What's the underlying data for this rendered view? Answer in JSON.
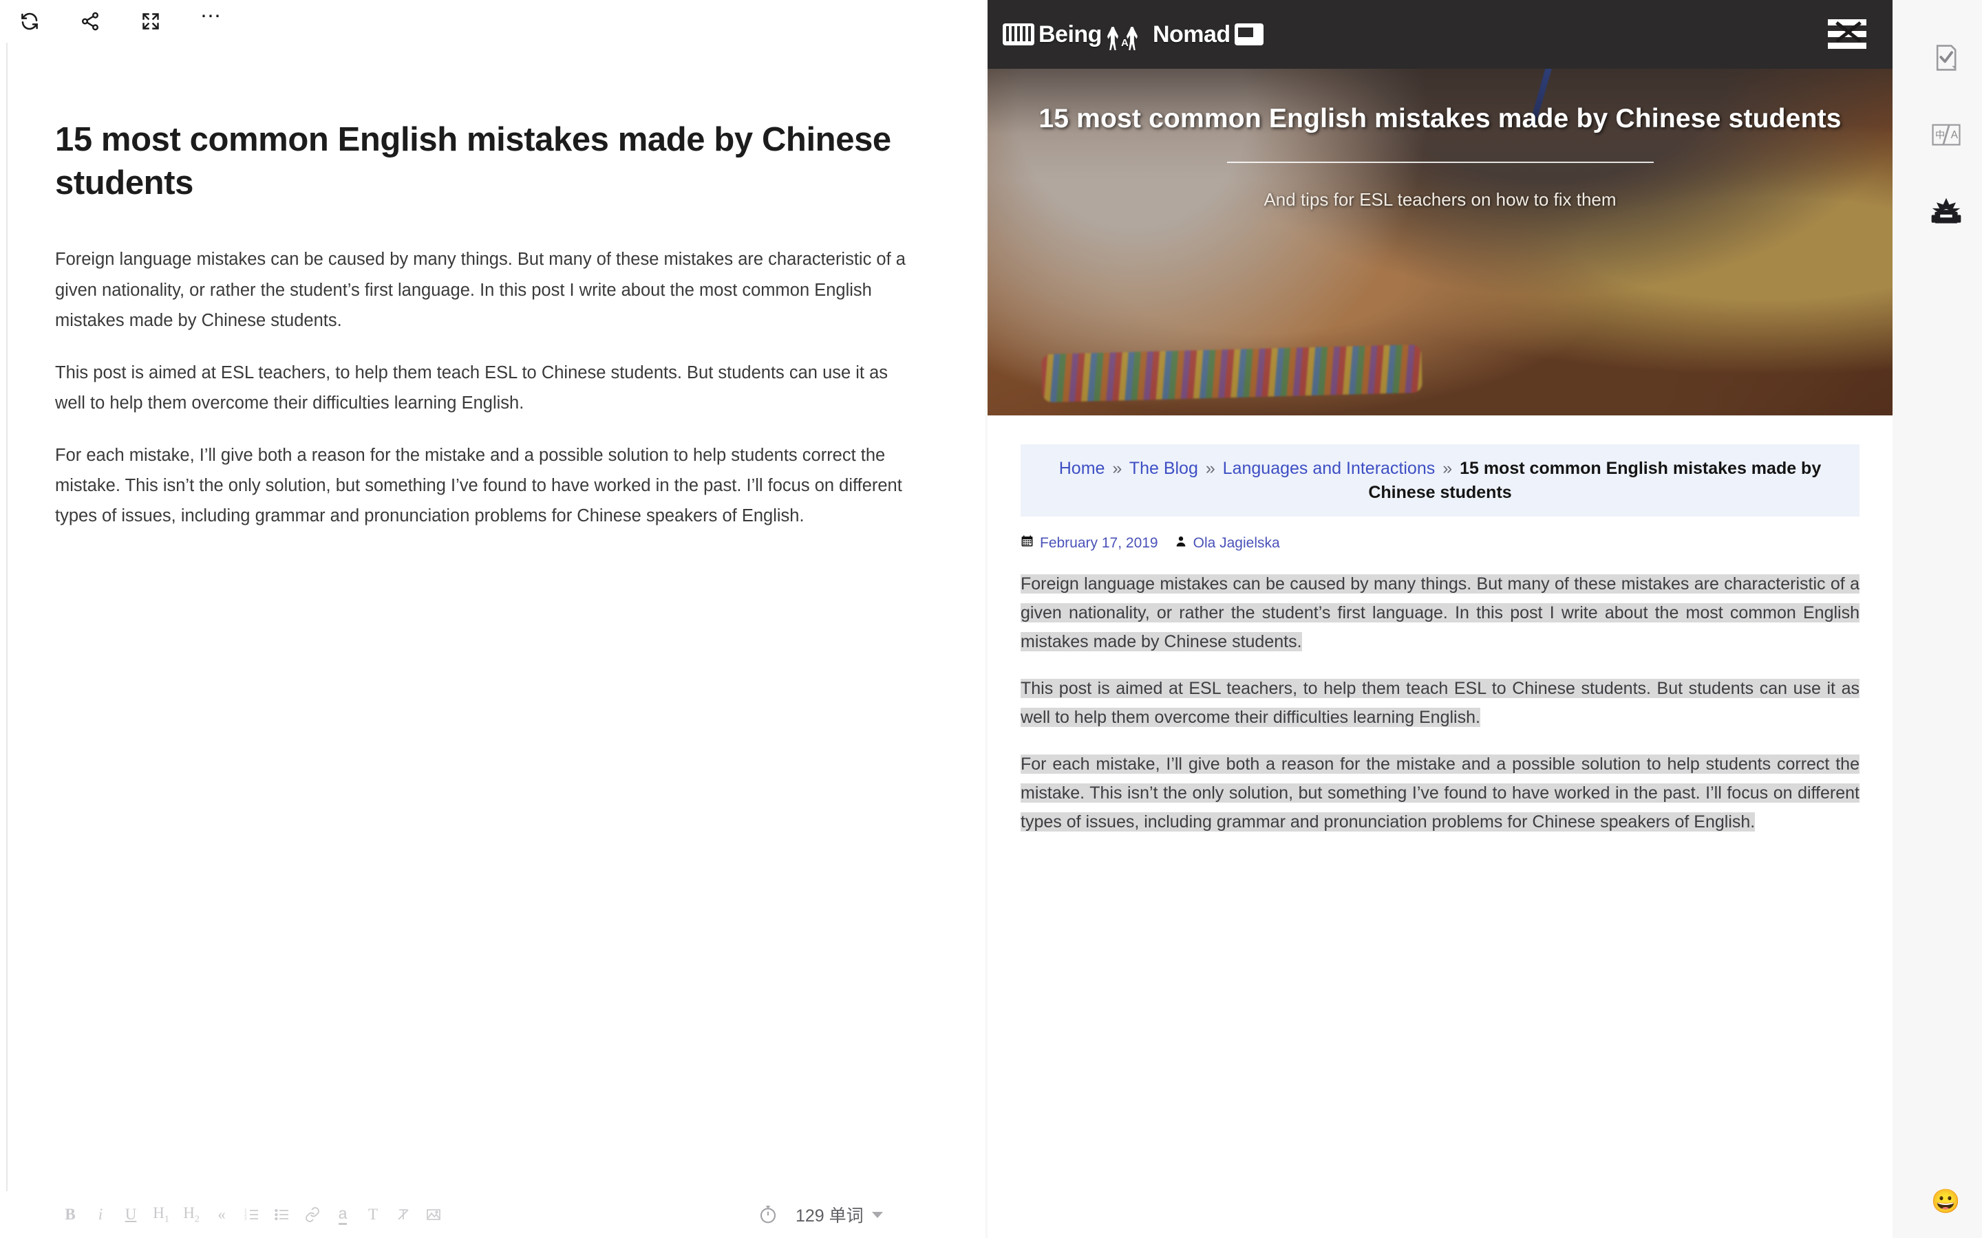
{
  "editor": {
    "toolbar_top": [
      {
        "name": "refresh-sync-icon",
        "label": "Sync"
      },
      {
        "name": "share-icon",
        "label": "Share"
      },
      {
        "name": "fullscreen-icon",
        "label": "Fullscreen"
      },
      {
        "name": "more-options-icon",
        "label": "More"
      }
    ],
    "title": "15 most common English mistakes made by Chinese students",
    "paragraphs": [
      "Foreign language mistakes can be caused by many things. But many of these mistakes are characteristic of a given nationality, or rather the student’s first language. In this post I write about the most common English mistakes made by Chinese students.",
      "This post is aimed at ESL teachers, to help them teach ESL to Chinese students. But students can use it as well to help them overcome their difficulties learning English.",
      "For each mistake, I’ll give both a reason for the mistake and a possible solution to help students correct the mistake. This isn’t the only solution, but something I’ve found to have worked in the past. I’ll focus on different types of issues, including grammar and pronunciation problems for Chinese speakers of English."
    ],
    "format_buttons": [
      {
        "name": "bold-button",
        "label": "B"
      },
      {
        "name": "italic-button",
        "label": "i"
      },
      {
        "name": "underline-button",
        "label": "U"
      },
      {
        "name": "heading-1-button",
        "label": "H1"
      },
      {
        "name": "heading-2-button",
        "label": "H2"
      },
      {
        "name": "blockquote-button",
        "label": "“"
      },
      {
        "name": "ordered-list-button",
        "label": "ordered-list"
      },
      {
        "name": "unordered-list-button",
        "label": "bullet-list"
      },
      {
        "name": "link-button",
        "label": "link"
      },
      {
        "name": "highlight-button",
        "label": "a"
      },
      {
        "name": "text-style-button",
        "label": "T"
      },
      {
        "name": "clear-format-button",
        "label": "clear"
      },
      {
        "name": "insert-image-button",
        "label": "image"
      }
    ],
    "status": {
      "timer_icon": "stopwatch-icon",
      "word_count": "129 单词"
    }
  },
  "preview": {
    "site": {
      "brand_being": "Being",
      "brand_a": "A",
      "brand_nomad": "Nomad",
      "menu_icon": "hamburger-close-icon"
    },
    "hero": {
      "title": "15 most common English mistakes made by Chinese students",
      "subtitle": "And tips for ESL teachers on how to fix them"
    },
    "breadcrumb": {
      "home": "Home",
      "blog": "The Blog",
      "category": "Languages and Interactions",
      "separator": "»",
      "current": "15 most common English mistakes made by Chinese students"
    },
    "meta": {
      "date": "February 17, 2019",
      "author": "Ola Jagielska"
    },
    "paragraphs": [
      "Foreign language mistakes can be caused by many things. But many of these mistakes are characteristic of a given nationality, or rather the student’s first language. In this post I write about the most common English mistakes made by Chinese students.",
      "This post is aimed at ESL teachers, to help them teach ESL to Chinese students. But students can use it as well to help them overcome their difficulties learning English.",
      "For each mistake, I’ll give both a reason for the mistake and a possible solution to help students correct the mistake. This isn’t the only solution, but something I’ve found to have worked in the past. I’ll focus on different types of issues, including grammar and pronunciation problems for Chinese speakers of English."
    ]
  },
  "rail": {
    "icons": [
      {
        "name": "proofread-check-icon",
        "label": "Proofread"
      },
      {
        "name": "translate-icon",
        "label": "Translate"
      },
      {
        "name": "typewriter-icon",
        "label": "Writing tools"
      }
    ],
    "emoji": "😀"
  },
  "colors": {
    "header_bg": "#2c2a2b",
    "breadcrumb_bg": "#eef2fa",
    "link_blue": "#3d4fc4",
    "highlight_grey": "#d9d9d9"
  }
}
